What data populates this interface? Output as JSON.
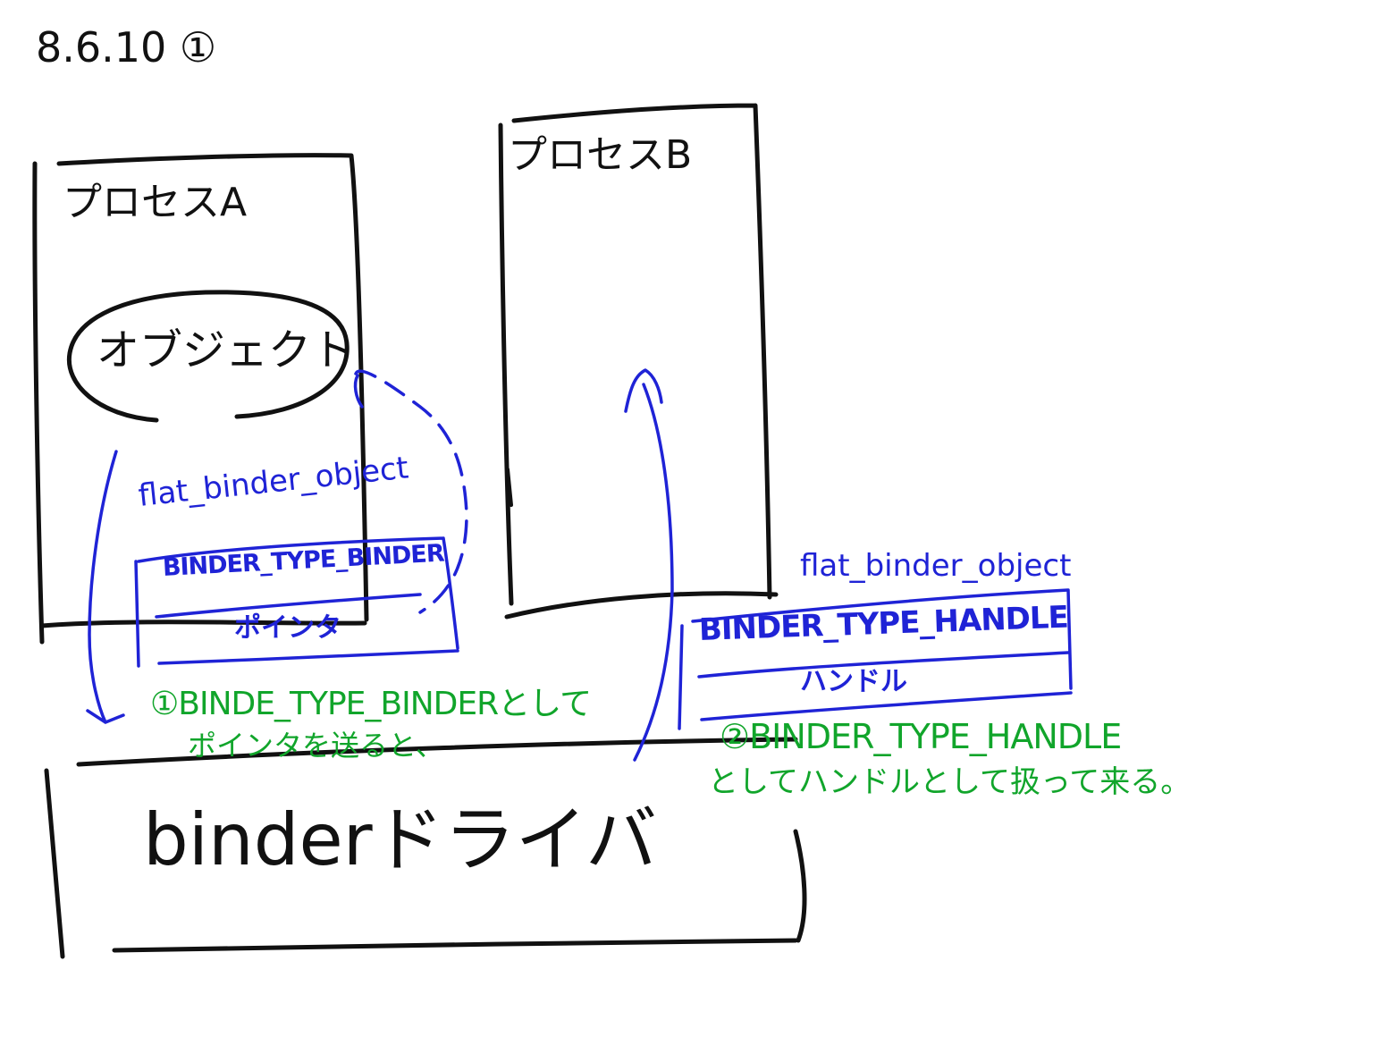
{
  "page_label": "8.6.10 ①",
  "colors": {
    "ink_black": "#111111",
    "ink_blue": "#1f23d6",
    "ink_green": "#11a52b",
    "background": "#ffffff"
  },
  "process_a": {
    "title": "プロセスA",
    "object_label": "オブジェクト"
  },
  "process_b": {
    "title": "プロセスB"
  },
  "flat_obj_a": {
    "title": "flat_binder_object",
    "type_field": "BINDER_TYPE_BINDER",
    "value_field": "ポインタ"
  },
  "flat_obj_b": {
    "title": "flat_binder_object",
    "type_field": "BINDER_TYPE_HANDLE",
    "value_field": "ハンドル"
  },
  "driver": {
    "label": "binderドライバ"
  },
  "note_1": {
    "line1": "①BINDE_TYPE_BINDERとして",
    "line2": "ポインタを送ると、"
  },
  "note_2": {
    "line1": "②BINDER_TYPE_HANDLE",
    "line2": "としてハンドルとして扱って来る。"
  }
}
